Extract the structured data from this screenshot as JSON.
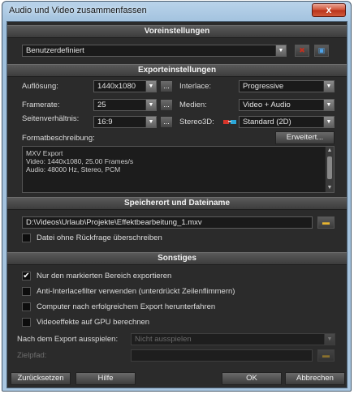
{
  "window": {
    "title": "Audio und Video zusammenfassen",
    "close_glyph": "x"
  },
  "sections": {
    "presets": "Voreinstellungen",
    "export": "Exporteinstellungen",
    "location": "Speicherort und Dateiname",
    "misc": "Sonstiges"
  },
  "presets": {
    "value": "Benutzerdefiniert"
  },
  "export": {
    "resolution_label": "Auflösung:",
    "resolution_value": "1440x1080",
    "framerate_label": "Framerate:",
    "framerate_value": "25",
    "aspect_label": "Seitenverhältnis:",
    "aspect_value": "16:9",
    "interlace_label": "Interlace:",
    "interlace_value": "Progressive",
    "media_label": "Medien:",
    "media_value": "Video + Audio",
    "stereo_label": "Stereo3D:",
    "stereo_value": "Standard (2D)",
    "format_label": "Formatbeschreibung:",
    "advanced_button": "Erweitert...",
    "more_glyph": "...",
    "format_lines": [
      "MXV Export",
      "Video: 1440x1080, 25.00 Frames/s",
      "Audio: 48000 Hz, Stereo, PCM"
    ]
  },
  "location": {
    "path": "D:\\Videos\\Urlaub\\Projekte\\Effektbearbeitung_1.mxv",
    "overwrite_label": "Datei ohne Rückfrage überschreiben"
  },
  "misc": {
    "options": [
      {
        "label": "Nur den markierten Bereich exportieren",
        "checked": true
      },
      {
        "label": "Anti-Interlacefilter verwenden (unterdrückt Zeilenflimmern)",
        "checked": false
      },
      {
        "label": "Computer nach erfolgreichem Export herunterfahren",
        "checked": false
      },
      {
        "label": "Videoeffekte auf GPU berechnen",
        "checked": false
      }
    ],
    "after_export_label": "Nach dem Export ausspielen:",
    "after_export_value": "Nicht ausspielen",
    "target_label": "Zielpfad:"
  },
  "footer": {
    "reset": "Zurücksetzen",
    "help": "Hilfe",
    "ok": "OK",
    "cancel": "Abbrechen"
  },
  "icons": {
    "delete": "delete-icon",
    "save": "save-icon",
    "folder": "folder-icon",
    "dropdown": "chevron-down-icon"
  }
}
